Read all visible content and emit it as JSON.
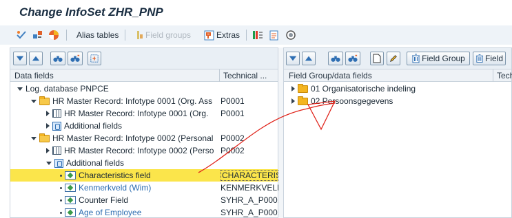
{
  "window": {
    "title": "Change InfoSet ZHR_PNP"
  },
  "toolbar": {
    "alias_tables": "Alias tables",
    "field_groups": "Field groups",
    "extras": "Extras"
  },
  "left_pane": {
    "columns": [
      "Data fields",
      "Technical ..."
    ],
    "rows": [
      {
        "label": "Log. database PNPCE",
        "tech": ""
      },
      {
        "label": "HR Master Record: Infotype 0001 (Org. Ass",
        "tech": "P0001"
      },
      {
        "label": "HR Master Record: Infotype 0001 (Org.",
        "tech": "P0001"
      },
      {
        "label": "Additional fields",
        "tech": ""
      },
      {
        "label": "HR Master Record: Infotype 0002 (Personal",
        "tech": "P0002"
      },
      {
        "label": "HR Master Record: Infotype 0002 (Perso",
        "tech": "P0002"
      },
      {
        "label": "Additional fields",
        "tech": ""
      },
      {
        "label": "Characteristics field",
        "tech": "CHARACTERIS..."
      },
      {
        "label": "Kenmerkveld (Wim)",
        "tech": "KENMERKVELD."
      },
      {
        "label": "Counter Field",
        "tech": "SYHR_A_P000."
      },
      {
        "label": "Age of Employee",
        "tech": "SYHR_A_P000."
      }
    ]
  },
  "right_pane": {
    "buttons": {
      "field_group": "Field Group",
      "field": "Field"
    },
    "columns": [
      "Field Group/data fields",
      "Tech"
    ],
    "rows": [
      {
        "label": "01 Organisatorische indeling"
      },
      {
        "label": "02 Persoonsgegevens"
      }
    ]
  },
  "colors": {
    "selection": "#fbe54b",
    "annotation_highlight": "#f0f23a",
    "annotation_stroke": "#e0241b"
  }
}
